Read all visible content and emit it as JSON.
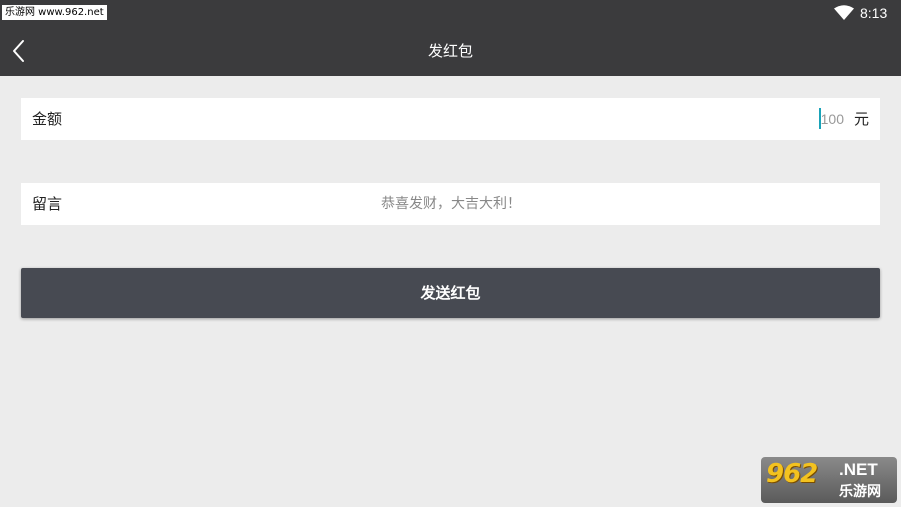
{
  "status_bar": {
    "watermark": "乐游网 www.962.net",
    "time": "8:13",
    "wifi_icon": "wifi-icon"
  },
  "app_bar": {
    "title": "发红包",
    "back_icon": "chevron-left-icon"
  },
  "form": {
    "amount": {
      "label": "金额",
      "placeholder": "100",
      "unit": "元"
    },
    "message": {
      "label": "留言",
      "placeholder": "恭喜发财，大吉大利！"
    }
  },
  "send_button": {
    "label": "发送红包"
  },
  "logo": {
    "number": "962",
    "domain": ".NET",
    "name": "乐游网"
  },
  "colors": {
    "app_bar": "#3b3b3d",
    "background": "#ececec",
    "button": "#474a52",
    "caret": "#1aa3b8"
  }
}
